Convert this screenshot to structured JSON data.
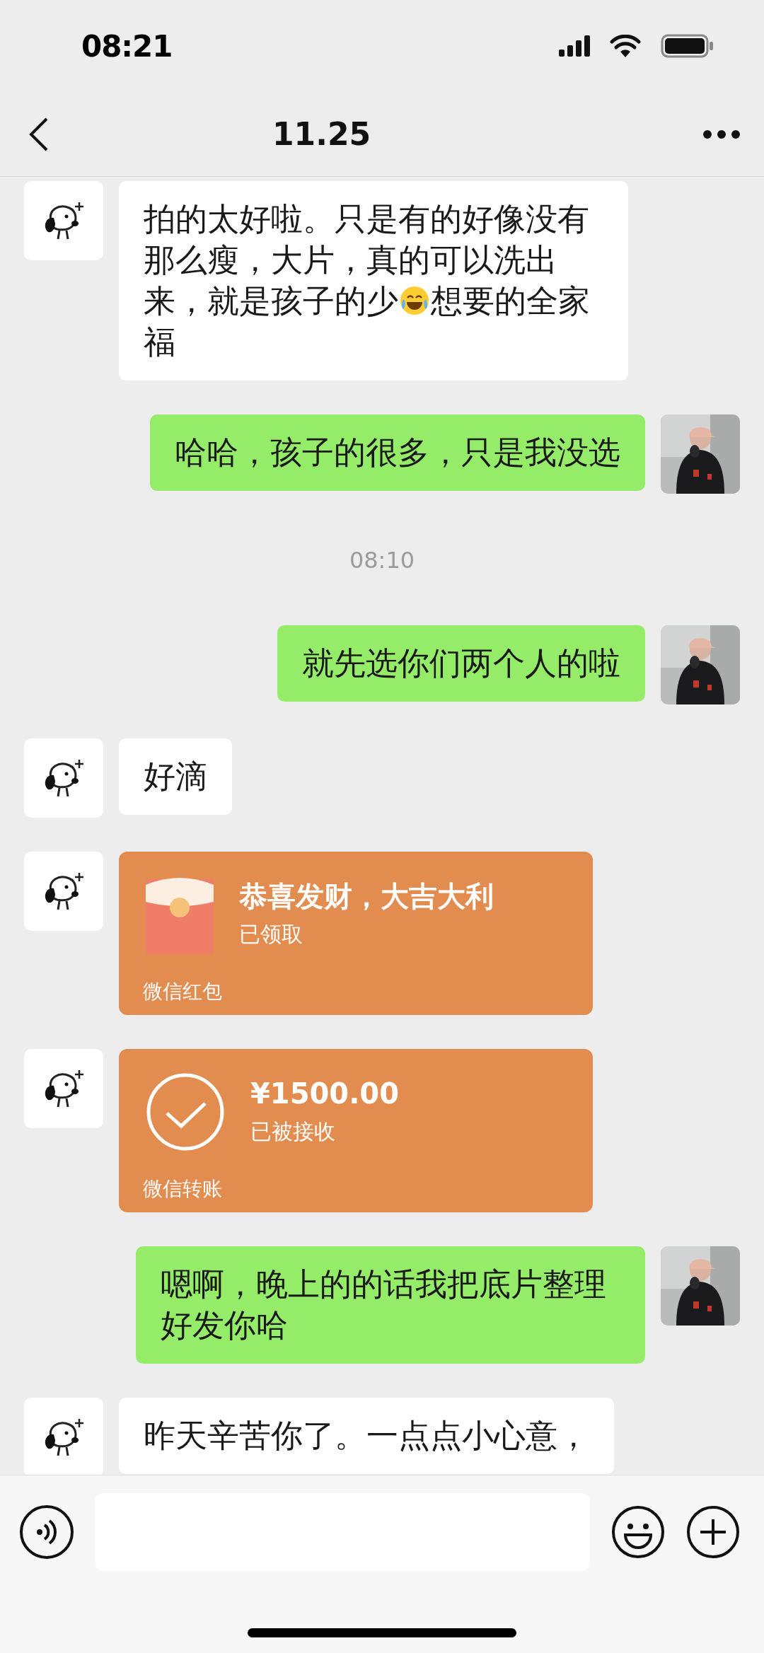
{
  "status_bar": {
    "time": "08:21"
  },
  "nav": {
    "title": "11.25"
  },
  "messages": [
    {
      "kind": "text",
      "outgoing": false,
      "parts": [
        {
          "kind": "block",
          "text": "拍的太好啦。只是有的好像没有那么瘦，大片，真的可以洗出"
        },
        {
          "kind": "inline",
          "text": "来，就是孩子的少"
        },
        {
          "kind": "laughing_emoji"
        },
        {
          "kind": "inline",
          "text": "想要的全家"
        },
        {
          "kind": "block",
          "text": "福"
        }
      ]
    },
    {
      "kind": "text",
      "outgoing": true,
      "parts": [
        {
          "kind": "block",
          "text": "哈哈，孩子的很多，只是我没选"
        }
      ]
    },
    {
      "kind": "time",
      "text": "08:10"
    },
    {
      "kind": "text",
      "outgoing": true,
      "parts": [
        {
          "kind": "block",
          "text": "就先选你们两个人的啦"
        }
      ]
    },
    {
      "kind": "text",
      "outgoing": false,
      "parts": [
        {
          "kind": "block",
          "text": "好滴"
        }
      ]
    },
    {
      "kind": "red_packet",
      "outgoing": false,
      "title": "恭喜发财，大吉大利",
      "status": "已领取",
      "footer": "微信红包"
    },
    {
      "kind": "transfer",
      "outgoing": false,
      "amount": "¥1500.00",
      "status": "已被接收",
      "footer": "微信转账"
    },
    {
      "kind": "text",
      "outgoing": true,
      "parts": [
        {
          "kind": "block",
          "text": "嗯啊，晚上的的话我把底片整理好发你哈"
        }
      ]
    },
    {
      "kind": "text",
      "outgoing": false,
      "parts": [
        {
          "kind": "block",
          "text": "昨天辛苦你了。一点点小心意，"
        }
      ]
    }
  ]
}
